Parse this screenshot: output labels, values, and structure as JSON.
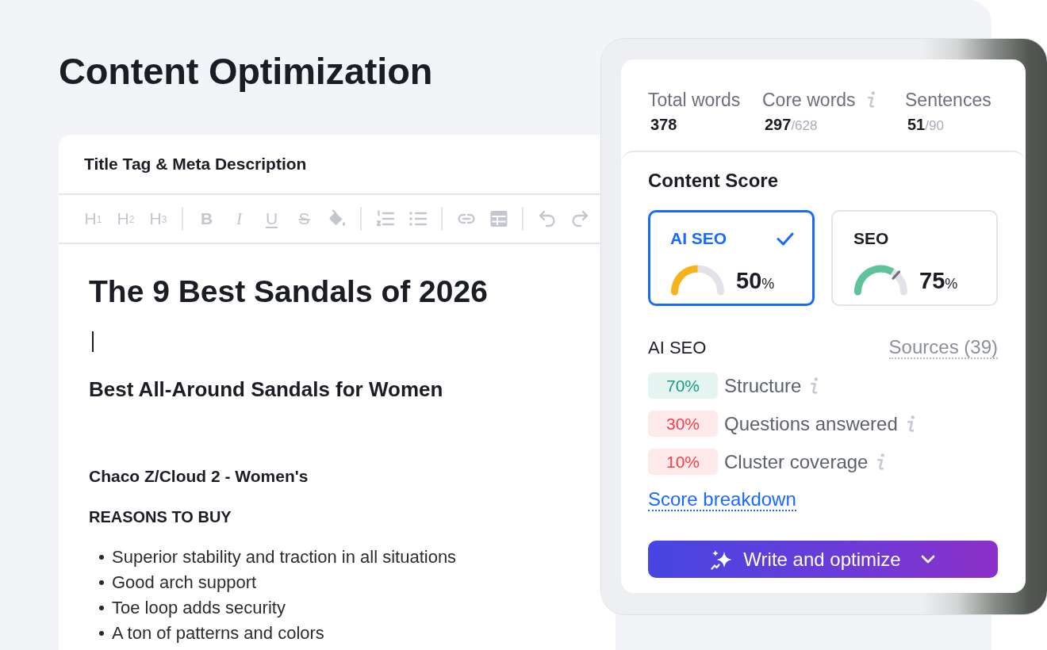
{
  "page_title": "Content Optimization",
  "editor": {
    "header": "Title Tag & Meta Description",
    "toolbar_groups": [
      {
        "items": [
          {
            "kind": "heading",
            "label": "H$_{1}$"
          },
          {
            "kind": "heading",
            "label": "H$_{2}$"
          },
          {
            "kind": "heading",
            "label": "H$_{3}$"
          }
        ]
      },
      {
        "items": [
          {
            "kind": "bold",
            "label": "B"
          },
          {
            "kind": "italic",
            "label": "I"
          },
          {
            "kind": "underline",
            "label": "U"
          },
          {
            "kind": "strikethrough",
            "label": "S"
          },
          {
            "kind": "fill-color"
          }
        ]
      },
      {
        "items": [
          {
            "kind": "ordered-list"
          },
          {
            "kind": "bullet-list"
          }
        ]
      },
      {
        "items": [
          {
            "kind": "link"
          },
          {
            "kind": "table"
          }
        ]
      },
      {
        "items": [
          {
            "kind": "undo"
          },
          {
            "kind": "redo"
          }
        ]
      }
    ],
    "document": {
      "title": "The 9 Best Sandals of 2026",
      "subtitle": "Best All-Around Sandals for Women",
      "product": "Chaco Z/Cloud 2 - Women's",
      "section": "REASONS TO BUY",
      "bullets": [
        "Superior stability and traction in all situations",
        "Good arch support",
        "Toe loop adds security",
        "A ton of patterns and colors"
      ]
    }
  },
  "panel": {
    "stats": [
      {
        "label": "Total words",
        "value": "378",
        "info": false
      },
      {
        "label": "Core words",
        "value": "297",
        "total": "/628",
        "info": true
      },
      {
        "label": "Sentences",
        "value": "51",
        "total": "/90",
        "info": false
      }
    ],
    "content_score": {
      "title": "Content Score",
      "cards": [
        {
          "label": "AI SEO",
          "value": "50",
          "unit": "%",
          "level": 0.5,
          "color": "#f5b41a",
          "selected": true,
          "marker": false
        },
        {
          "label": "SEO",
          "value": "75",
          "unit": "%",
          "level": 0.75,
          "color": "#5ec29b",
          "selected": false,
          "marker": true
        }
      ]
    },
    "ai_seo": {
      "title": "AI SEO",
      "sources_link": "Sources (39)",
      "metrics": [
        {
          "value": "70%",
          "label": "Structure",
          "color": "#1c9a84",
          "info": true
        },
        {
          "value": "30%",
          "label": "Questions answered",
          "color": "#f23f4b",
          "info": true
        },
        {
          "value": "10%",
          "label": "Cluster coverage",
          "color": "#f23f4b",
          "info": true
        }
      ],
      "breakdown_link": "Score breakdown"
    },
    "action_button": "Write and optimize"
  }
}
